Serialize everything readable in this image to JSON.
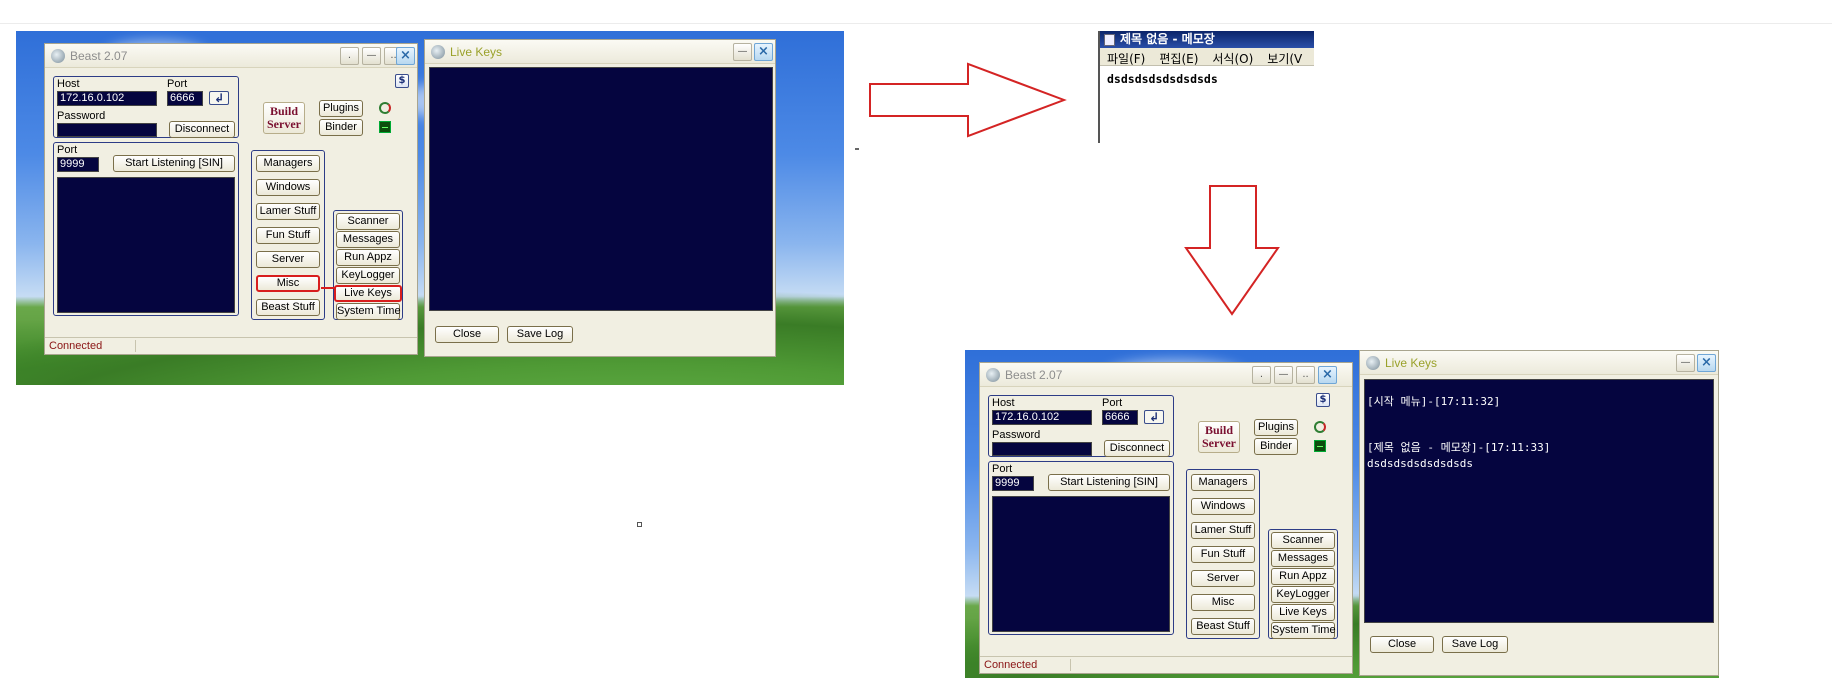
{
  "beast": {
    "title": "Beast 2.07",
    "host_label": "Host",
    "host_value": "172.16.0.102",
    "port_label": "Port",
    "port_value": "6666",
    "password_label": "Password",
    "password_value": "",
    "disconnect_label": "Disconnect",
    "listen_port_label": "Port",
    "listen_port_value": "9999",
    "start_listening_label": "Start Listening [SIN]",
    "build_server_line1": "Build",
    "build_server_line2": "Server",
    "plugins_label": "Plugins",
    "binder_label": "Binder",
    "left_buttons": [
      "Managers",
      "Windows",
      "Lamer Stuff",
      "Fun Stuff",
      "Server",
      "Misc",
      "Beast Stuff"
    ],
    "right_buttons": [
      "Scanner",
      "Messages",
      "Run Appz",
      "KeyLogger",
      "Live Keys",
      "System Time"
    ],
    "status": "Connected",
    "titlebar_buttons": [
      ".",
      "",
      "..",
      "X"
    ],
    "dollar_icon": "$",
    "arrow_icon": "↲"
  },
  "live_keys": {
    "title": "Live Keys",
    "close_label": "Close",
    "save_log_label": "Save Log",
    "log_line1": "[시작 메뉴]-[17:11:32]",
    "log_line2": "[제목 없음 - 메모장]-[17:11:33]",
    "log_line3": "dsdsdsdsdsdsdsds"
  },
  "notepad": {
    "title": "제목 없음 - 메모장",
    "menu": [
      "파일(F)",
      "편집(E)",
      "서식(O)",
      "보기(V"
    ],
    "content": "dsdsdsdsdsdsdsds"
  },
  "colors": {
    "arrow_red": "#d42424",
    "highlight_red": "#d81e1e",
    "navy": "#05053f"
  }
}
